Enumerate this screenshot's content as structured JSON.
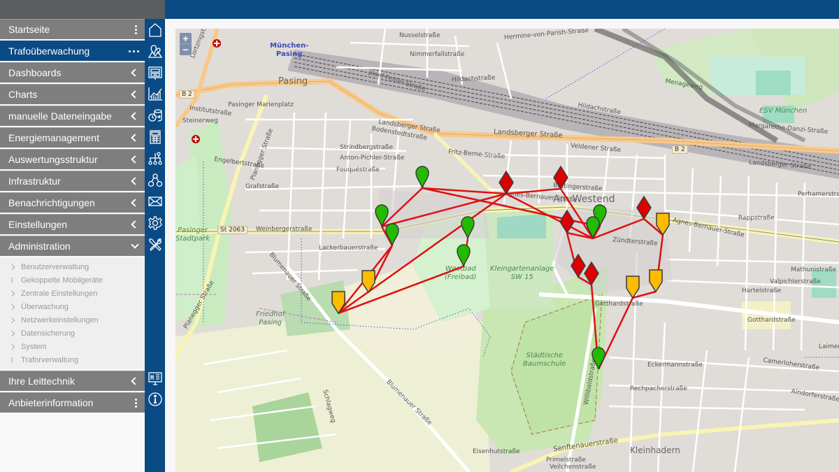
{
  "sidebar": {
    "items": [
      {
        "label": "Startseite",
        "glyph": "kebab"
      },
      {
        "label": "Trafoüberwachung",
        "glyph": "hdots",
        "active": true
      },
      {
        "label": "Dashboards",
        "glyph": "chevron-left"
      },
      {
        "label": "Charts",
        "glyph": "chevron-left"
      },
      {
        "label": "manuelle Dateneingabe",
        "glyph": "chevron-left"
      },
      {
        "label": "Energiemanagement",
        "glyph": "chevron-left"
      },
      {
        "label": "Auswertungsstruktur",
        "glyph": "chevron-left"
      },
      {
        "label": "Infrastruktur",
        "glyph": "chevron-left"
      },
      {
        "label": "Benachrichtigungen",
        "glyph": "chevron-left"
      },
      {
        "label": "Einstellungen",
        "glyph": "chevron-left"
      },
      {
        "label": "Administration",
        "glyph": "chevron-down",
        "expanded": true
      }
    ],
    "administration_subitems": [
      {
        "label": "Benutzerverwaltung",
        "glyph": "chevron-right"
      },
      {
        "label": "Gekoppelte Mobilgeräte",
        "glyph": "kebab"
      },
      {
        "label": "Zentrale Einstellungen",
        "glyph": "chevron-right"
      },
      {
        "label": "Überwachung",
        "glyph": "chevron-right"
      },
      {
        "label": "Netzwerkeinstellungen",
        "glyph": "chevron-right"
      },
      {
        "label": "Datensicherung",
        "glyph": "chevron-right"
      },
      {
        "label": "System",
        "glyph": "chevron-right"
      },
      {
        "label": "Traforverwaltung",
        "glyph": "kebab"
      }
    ],
    "bottom_items": [
      {
        "label": "Ihre Leittechnik",
        "glyph": "chevron-left"
      },
      {
        "label": "Anbieterinformation",
        "glyph": "kebab"
      }
    ]
  },
  "iconbar": {
    "icons": [
      "home-icon",
      "map-icon",
      "dashboard-icon",
      "chart-icon",
      "data-entry-icon",
      "calculator-icon",
      "hierarchy-icon",
      "network-icon",
      "mail-icon",
      "gear-icon",
      "tools-icon"
    ],
    "bottom_icons": [
      "control-system-icon",
      "info-icon"
    ]
  },
  "map": {
    "zoom_in": "+",
    "zoom_out": "−",
    "places": {
      "station": "München-\nPasing",
      "pasing": "Pasing",
      "am_westend": "Am Westend",
      "kleinhadern": "Kleinhadern",
      "westbad": "Westbad\n(Freibad)",
      "kleingarten": "Kleingartenanlage\nSW 15",
      "baumschule": "Städtische\nBaumschule",
      "friedhof": "Friedhof\nPasing",
      "stadtpark": "Pasinger\nStadtpark",
      "esv": "ESV München"
    },
    "shields": {
      "b2_left": "B 2",
      "b2_right": "B 2",
      "st2063": "St 2063"
    },
    "streets": {
      "lortzing": "Lortzingstraße",
      "josef_felder": "Josef-Felder-Straße",
      "landsberger1": "Landsberger Straße",
      "landsberger2": "Landsberger Straße",
      "landsberger3": "Landsberger Straße",
      "marienplatz": "Pasinger Marienplatz",
      "planegger": "Planegger Straße",
      "planegger2": "Planegger Straße",
      "weinberger": "Weinbergerstraße",
      "agnes": "Agnes-Bernauer-Straße",
      "agnes2": "Agnes-Bernauer-Straße",
      "graf": "Grafstraße",
      "fouque": "Fouquéstraße",
      "lackerbauer": "Lackerbauerstraße",
      "zuendter": "Zündterstraße",
      "gotthard": "Gotthardstraße",
      "gotthard2": "Gotthardstraße",
      "senftenauer": "Senftenauerstraße",
      "hildach": "Hildachstraße",
      "nussel": "Nusselstraße",
      "nimmerfall": "Nimmerfallstraße",
      "margarethe": "Margarethe-Danzi-Straße",
      "engelbert": "Engelbertstraße",
      "perhamer": "Perhamerstraße",
      "rappstr": "Rappstraße",
      "valpichler": "Valpichlerstraße",
      "mathunis": "Mathunistraße",
      "camerloher": "Camerloherstraße",
      "andorfer": "Aindorferstraße",
      "hartel": "Hartelstraße",
      "willibald": "Willibaldstraße",
      "blumenauer": "Blumenauer Straße",
      "schlagweg": "Schlagweg",
      "eckermann": "Eckermannstraße",
      "rechpacher": "Rechpacherstraße",
      "primel": "Primelstraße",
      "veilchen": "Veilchenstraße",
      "eisenhut": "Eisenhutstraße",
      "bodensted": "Bodenstedtstraße",
      "strindberg": "Strindbergstraße",
      "anton": "Anton-Pichler-Straße",
      "veldener": "Veldener Straße",
      "boettinger": "Böttingerstraße",
      "laimer": "Laimer Platz",
      "institut": "Institutstraße",
      "steinerweg": "Steinerweg",
      "fritz": "Fritz-Berne-Straße",
      "hermine": "Hermine-von-Parish-Straße",
      "menage": "Menageweg",
      "hildach2": "Hildachstraße"
    },
    "marker_colors": {
      "ok": "#22bb00",
      "warning": "#ffbb00",
      "alarm": "#dd0000",
      "line": "#dd1111"
    },
    "markers": [
      {
        "status": "ok",
        "shape": "pin",
        "id": "g1"
      },
      {
        "status": "ok",
        "shape": "pin",
        "id": "g2"
      },
      {
        "status": "ok",
        "shape": "pin",
        "id": "g3"
      },
      {
        "status": "ok",
        "shape": "pin",
        "id": "g4"
      },
      {
        "status": "ok",
        "shape": "pin",
        "id": "g5"
      },
      {
        "status": "ok",
        "shape": "pin",
        "id": "g6"
      },
      {
        "status": "ok",
        "shape": "pin",
        "id": "g7"
      },
      {
        "status": "ok",
        "shape": "pin",
        "id": "g8"
      },
      {
        "status": "warning",
        "shape": "shield",
        "id": "y1"
      },
      {
        "status": "warning",
        "shape": "shield",
        "id": "y2"
      },
      {
        "status": "warning",
        "shape": "shield",
        "id": "y3"
      },
      {
        "status": "warning",
        "shape": "shield",
        "id": "y4"
      },
      {
        "status": "warning",
        "shape": "shield",
        "id": "y5"
      },
      {
        "status": "alarm",
        "shape": "diamond",
        "id": "r1"
      },
      {
        "status": "alarm",
        "shape": "diamond",
        "id": "r2"
      },
      {
        "status": "alarm",
        "shape": "diamond",
        "id": "r3"
      },
      {
        "status": "alarm",
        "shape": "diamond",
        "id": "r4"
      },
      {
        "status": "alarm",
        "shape": "diamond",
        "id": "r5"
      },
      {
        "status": "alarm",
        "shape": "diamond",
        "id": "r6"
      }
    ]
  }
}
